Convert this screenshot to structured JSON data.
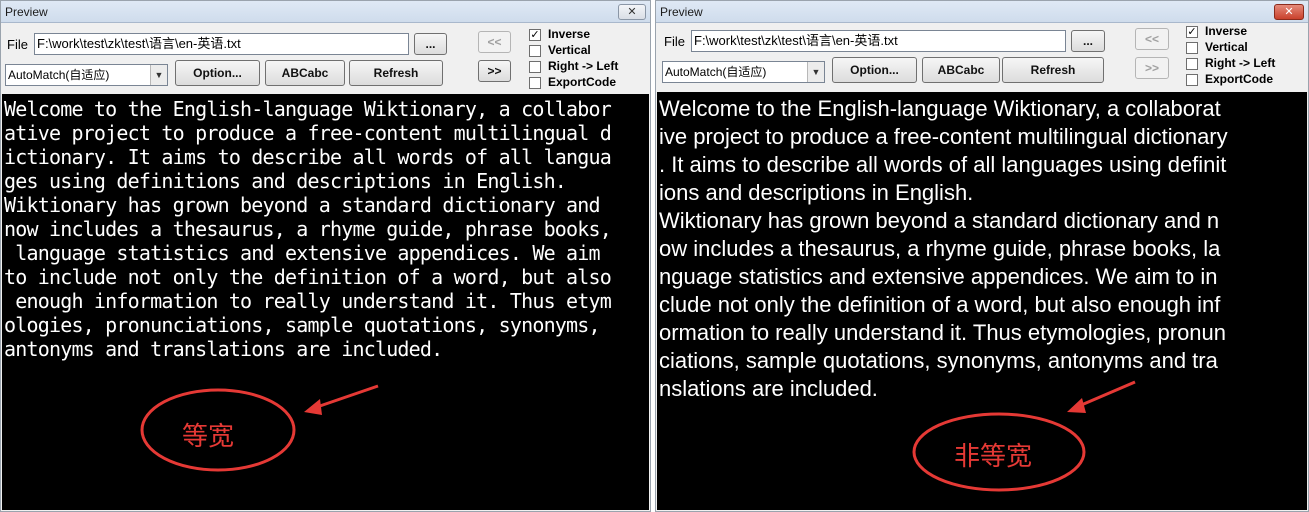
{
  "left": {
    "title": "Preview",
    "close_label": "✕",
    "file_label": "File",
    "file_path": "F:\\work\\test\\zk\\test\\语言\\en-英语.txt",
    "browse_label": "...",
    "prev_label": "<<",
    "next_label": ">>",
    "combo_value": "AutoMatch(自适应)",
    "option_label": "Option...",
    "abc_label": "ABCabc",
    "refresh_label": "Refresh",
    "checks": [
      {
        "label": "Inverse",
        "checked": true,
        "mark": "✓"
      },
      {
        "label": "Vertical",
        "checked": false,
        "mark": ""
      },
      {
        "label": "Right -> Left",
        "checked": false,
        "mark": ""
      },
      {
        "label": "ExportCode",
        "checked": false,
        "mark": ""
      }
    ],
    "preview_lines": [
      "Welcome to the English-language Wiktionary, a collabor",
      "ative project to produce a free-content multilingual d",
      "ictionary. It aims to describe all words of all langua",
      "ges using definitions and descriptions in English.",
      "Wiktionary has grown beyond a standard dictionary and",
      "now includes a thesaurus, a rhyme guide, phrase books,",
      " language statistics and extensive appendices. We aim",
      "to include not only the definition of a word, but also",
      " enough information to really understand it. Thus etym",
      "ologies, pronunciations, sample quotations, synonyms,",
      "antonyms and translations are included."
    ],
    "annotation": "等宽"
  },
  "right": {
    "title": "Preview",
    "close_label": "✕",
    "file_label": "File",
    "file_path": "F:\\work\\test\\zk\\test\\语言\\en-英语.txt",
    "browse_label": "...",
    "prev_label": "<<",
    "next_label": ">>",
    "combo_value": "AutoMatch(自适应)",
    "option_label": "Option...",
    "abc_label": "ABCabc",
    "refresh_label": "Refresh",
    "checks": [
      {
        "label": "Inverse",
        "checked": true,
        "mark": "✓"
      },
      {
        "label": "Vertical",
        "checked": false,
        "mark": ""
      },
      {
        "label": "Right -> Left",
        "checked": false,
        "mark": ""
      },
      {
        "label": "ExportCode",
        "checked": false,
        "mark": ""
      }
    ],
    "preview_lines": [
      "Welcome to the English-language Wiktionary, a collaborat",
      "ive project to produce a free-content multilingual dictionary",
      ". It aims to describe all words of all languages using definit",
      "ions and descriptions in English.",
      "Wiktionary has grown beyond a standard dictionary and n",
      "ow includes a thesaurus, a rhyme guide, phrase books, la",
      "nguage statistics and extensive appendices. We aim to in",
      "clude not only the definition of a word, but also enough inf",
      "ormation to really understand it. Thus etymologies, pronun",
      "ciations, sample quotations, synonyms, antonyms and tra",
      "nslations are included."
    ],
    "annotation": "非等宽"
  },
  "colors": {
    "annotation": "#e53935",
    "preview_bg": "#000000",
    "preview_text": "#ffffff"
  }
}
